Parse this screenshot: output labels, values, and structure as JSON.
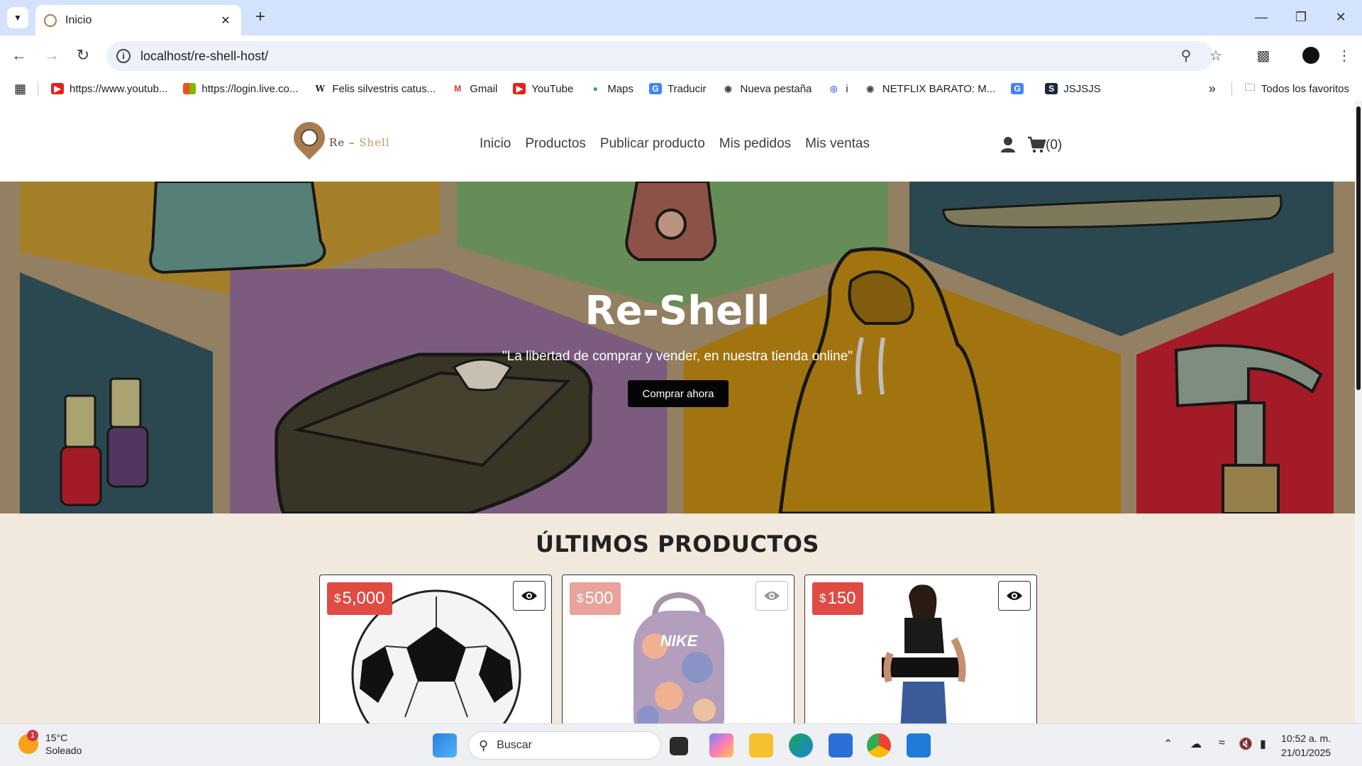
{
  "browser": {
    "tab_title": "Inicio",
    "url": "localhost/re-shell-host/",
    "bookmarks": [
      {
        "label": "https://www.youtub...",
        "icon": "youtube-icon"
      },
      {
        "label": "https://login.live.co...",
        "icon": "microsoft-icon"
      },
      {
        "label": "Felis silvestris catus...",
        "icon": "wikipedia-icon"
      },
      {
        "label": "Gmail",
        "icon": "gmail-icon"
      },
      {
        "label": "YouTube",
        "icon": "youtube-icon"
      },
      {
        "label": "Maps",
        "icon": "maps-icon"
      },
      {
        "label": "Traducir",
        "icon": "translate-icon"
      },
      {
        "label": "Nueva pestaña",
        "icon": "globe-icon"
      },
      {
        "label": "i",
        "icon": "fingerprint-icon"
      },
      {
        "label": "NETFLIX BARATO: M...",
        "icon": "globe-icon"
      },
      {
        "label": "",
        "icon": "translate-icon"
      },
      {
        "label": "JSJSJS",
        "icon": "steam-icon"
      }
    ],
    "all_bookmarks_label": "Todos los favoritos"
  },
  "site": {
    "logo_text_main": "Re – ",
    "logo_text_accent": "Shell",
    "nav": [
      "Inicio",
      "Productos",
      "Publicar producto",
      "Mis pedidos",
      "Mis ventas"
    ],
    "cart_count": "(0)"
  },
  "hero": {
    "title": "Re-Shell",
    "subtitle": "\"La libertad de comprar y vender, en nuestra tienda online\"",
    "cta": "Comprar ahora"
  },
  "products_section": {
    "title": "ÚLTIMOS PRODUCTOS",
    "currency": "$",
    "products": [
      {
        "price": "5,000",
        "name": "balón de fútbol"
      },
      {
        "price": "500",
        "name": "mochila Nike"
      },
      {
        "price": "150",
        "name": "faja"
      }
    ]
  },
  "taskbar": {
    "temperature": "15°C",
    "condition": "Soleado",
    "weather_badge": "1",
    "search_placeholder": "Buscar",
    "time": "10:52 a. m.",
    "date": "21/01/2025"
  },
  "colors": {
    "accent_price": "#e04b43",
    "cta_background": "#050505",
    "page_background": "#f1e9de",
    "tabstrip": "#d3e3fd"
  }
}
